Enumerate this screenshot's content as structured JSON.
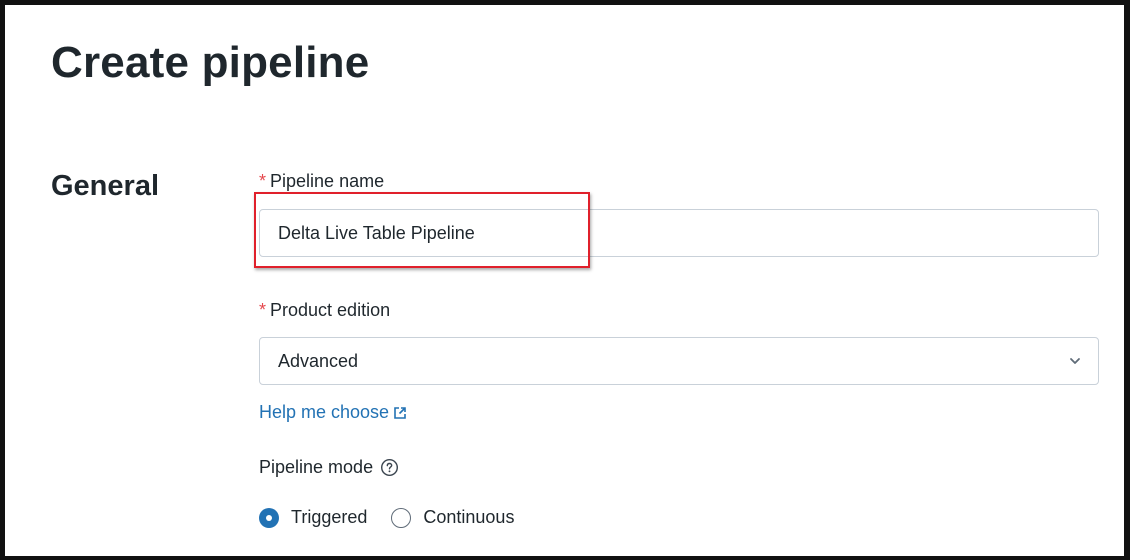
{
  "page": {
    "title": "Create pipeline"
  },
  "general": {
    "section_title": "General",
    "pipeline_name": {
      "required_mark": "*",
      "label": "Pipeline name",
      "value": "Delta Live Table Pipeline"
    },
    "product_edition": {
      "required_mark": "*",
      "label": "Product edition",
      "selected": "Advanced",
      "icon": "chevron-down-icon"
    },
    "help_link": {
      "label": "Help me choose",
      "icon": "external-link-icon"
    },
    "pipeline_mode": {
      "label": "Pipeline mode",
      "icon": "help-circle-icon",
      "options": [
        {
          "label": "Triggered",
          "checked": true
        },
        {
          "label": "Continuous",
          "checked": false
        }
      ]
    }
  },
  "annotation": {
    "highlight_color": "#e0202b"
  },
  "colors": {
    "accent": "#2272b4",
    "required": "#e5484d",
    "text": "#1f272d",
    "border": "#c9d1d9"
  }
}
